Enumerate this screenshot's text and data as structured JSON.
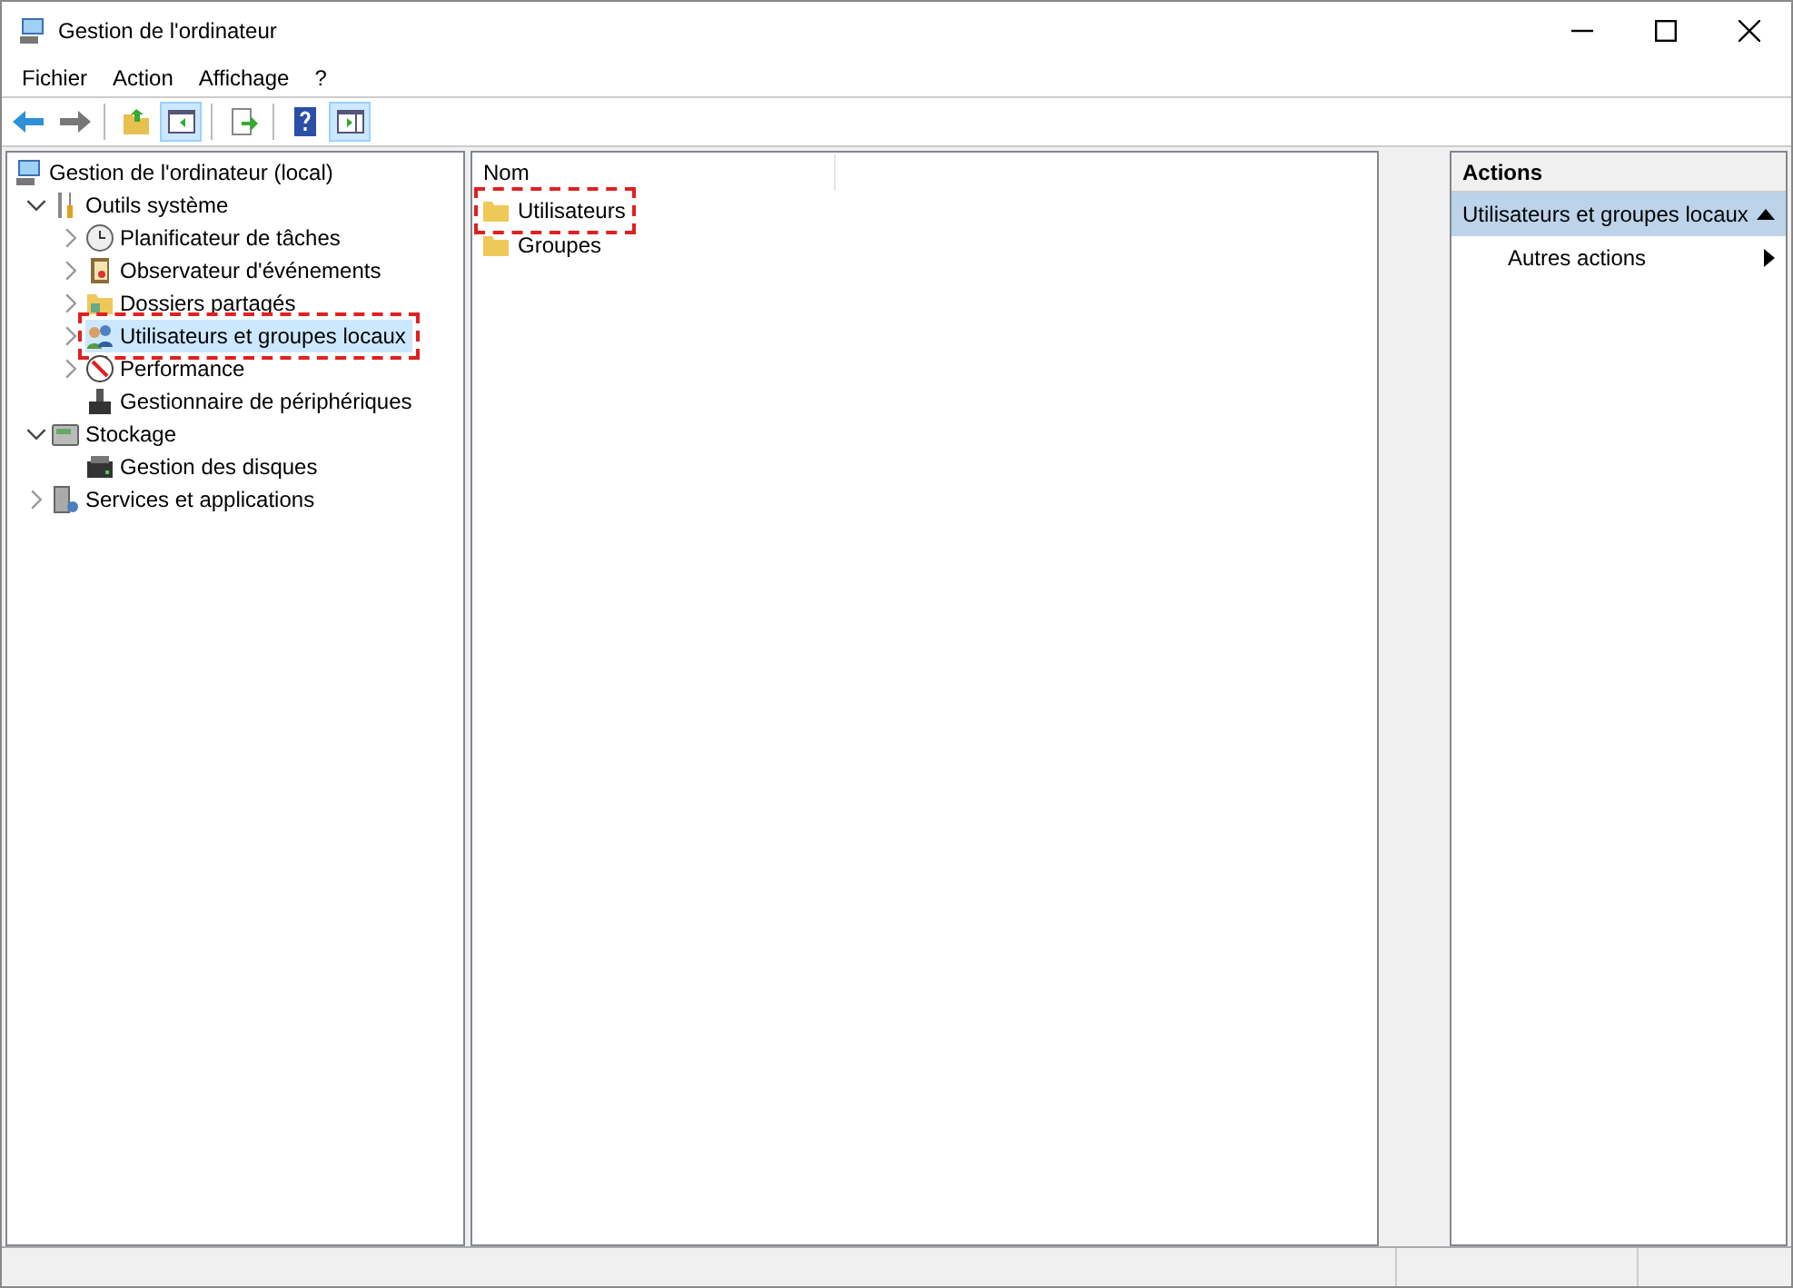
{
  "window": {
    "title": "Gestion de l'ordinateur"
  },
  "menu": [
    "Fichier",
    "Action",
    "Affichage",
    "?"
  ],
  "toolbar": [
    {
      "kind": "back",
      "pressed": false
    },
    {
      "kind": "forward",
      "pressed": false
    },
    {
      "kind": "sep"
    },
    {
      "kind": "up",
      "pressed": false
    },
    {
      "kind": "tree",
      "pressed": true
    },
    {
      "kind": "sep"
    },
    {
      "kind": "export",
      "pressed": false
    },
    {
      "kind": "sep"
    },
    {
      "kind": "help",
      "pressed": false
    },
    {
      "kind": "pane",
      "pressed": true
    }
  ],
  "tree": [
    {
      "label": "Gestion de l'ordinateur (local)",
      "kind": "computer",
      "selected": false,
      "highlighted": false,
      "children": [
        {
          "label": "Outils système",
          "kind": "tools",
          "expanded": true,
          "selected": false,
          "highlighted": false,
          "children": [
            {
              "label": "Planificateur de tâches",
              "kind": "clock",
              "expanded": false,
              "selected": false,
              "highlighted": false
            },
            {
              "label": "Observateur d'événements",
              "kind": "log",
              "expanded": false,
              "selected": false,
              "highlighted": false
            },
            {
              "label": "Dossiers partagés",
              "kind": "folder",
              "expanded": false,
              "selected": false,
              "highlighted": false
            },
            {
              "label": "Utilisateurs et groupes locaux",
              "kind": "users",
              "expanded": false,
              "selected": true,
              "highlighted": true
            },
            {
              "label": "Performance",
              "kind": "perf",
              "expanded": false,
              "selected": false,
              "highlighted": false
            },
            {
              "label": "Gestionnaire de périphériques",
              "kind": "device",
              "selected": false,
              "highlighted": false
            }
          ]
        },
        {
          "label": "Stockage",
          "kind": "storage",
          "expanded": true,
          "selected": false,
          "highlighted": false,
          "children": [
            {
              "label": "Gestion des disques",
              "kind": "disk",
              "selected": false,
              "highlighted": false
            }
          ]
        },
        {
          "label": "Services et applications",
          "kind": "services",
          "expanded": false,
          "selected": false,
          "highlighted": false
        }
      ]
    }
  ],
  "list": {
    "columns": [
      "Nom"
    ],
    "rows": [
      {
        "name": "Utilisateurs",
        "highlighted": true
      },
      {
        "name": "Groupes",
        "highlighted": false
      }
    ]
  },
  "actions": {
    "title": "Actions",
    "section": "Utilisateurs et groupes locaux",
    "items": [
      "Autres actions"
    ]
  }
}
